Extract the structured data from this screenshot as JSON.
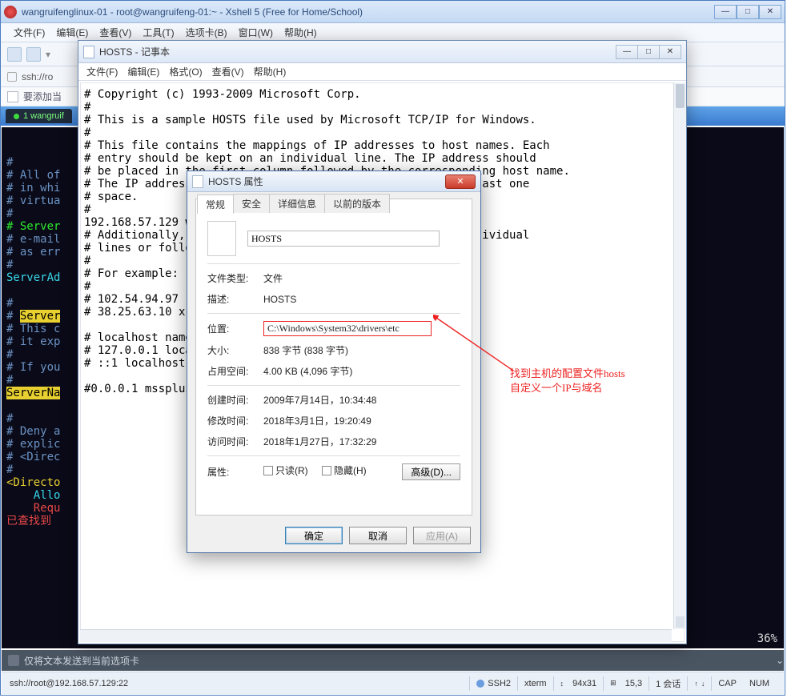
{
  "xshell": {
    "title": "wangruifenglinux-01 - root@wangruifeng-01:~ - Xshell 5 (Free for Home/School)",
    "menu": [
      "文件(F)",
      "编辑(E)",
      "查看(V)",
      "工具(T)",
      "选项卡(B)",
      "窗口(W)",
      "帮助(H)"
    ],
    "addr": "ssh://ro",
    "tip": "要添加当",
    "tab": "1 wangruif",
    "terminal_lines": [
      {
        "t": "#",
        "cls": "hash"
      },
      {
        "t": "# All of",
        "cls": "hash"
      },
      {
        "t": "# in whi",
        "cls": "hash"
      },
      {
        "t": "# virtua",
        "cls": "hash"
      },
      {
        "t": "#",
        "cls": "hash"
      },
      {
        "t": "# Server",
        "cls": "gr"
      },
      {
        "t": "# e-mail",
        "cls": "hash"
      },
      {
        "t": "# as err",
        "cls": "hash"
      },
      {
        "t": "#",
        "cls": "hash"
      },
      {
        "t": "ServerAd",
        "cls": "cy"
      },
      {
        "t": "",
        "cls": ""
      },
      {
        "t": "#",
        "cls": "hash"
      },
      {
        "t": "# ",
        "cls": "hash",
        "extra": "Server",
        "extracls": "ylhl"
      },
      {
        "t": "# This c",
        "cls": "hash"
      },
      {
        "t": "# it exp",
        "cls": "hash"
      },
      {
        "t": "#",
        "cls": "hash"
      },
      {
        "t": "# If you",
        "cls": "hash"
      },
      {
        "t": "#",
        "cls": "hash"
      },
      {
        "t": "ServerNa",
        "cls": "ylhl2"
      },
      {
        "t": "",
        "cls": ""
      },
      {
        "t": "#",
        "cls": "hash"
      },
      {
        "t": "# Deny a",
        "cls": "hash"
      },
      {
        "t": "# explic",
        "cls": "hash"
      },
      {
        "t": "# <Direc",
        "cls": "hash"
      },
      {
        "t": "#",
        "cls": "hash"
      },
      {
        "t": "<Directo",
        "cls": "yl"
      },
      {
        "t": "    Allo",
        "cls": "cy"
      },
      {
        "t": "    Requ",
        "cls": "rd"
      },
      {
        "t": "已查找到",
        "cls": "rd"
      }
    ],
    "pct": "36%",
    "cmdbar": "仅将文本发送到当前选项卡",
    "status": {
      "left": "ssh://root@192.168.57.129:22",
      "ssh": "SSH2",
      "term": "xterm",
      "size": "94x31",
      "pos": "15,3",
      "sess": "1 会话",
      "cap": "CAP",
      "num": "NUM"
    }
  },
  "notepad": {
    "title": "HOSTS - 记事本",
    "menu": [
      "文件(F)",
      "编辑(E)",
      "格式(O)",
      "查看(V)",
      "帮助(H)"
    ],
    "content": "# Copyright (c) 1993-2009 Microsoft Corp.\n#\n# This is a sample HOSTS file used by Microsoft TCP/IP for Windows.\n#\n# This file contains the mappings of IP addresses to host names. Each\n# entry should be kept on an individual line. The IP address should\n# be placed in the first column followed by the corresponding host name.\n# The IP address                                           ast one\n# space.\n#\n192.168.57.129 w\n# Additionally,                                            ividual\n# lines or follo\n#\n# For example:\n#\n# 102.54.94.97 r\n# 38.25.63.10 x.\n\n# localhost name\n# 127.0.0.1 loca\n# ::1 localhost\n\n#0.0.0.1 mssplus"
  },
  "prop": {
    "title": "HOSTS 属性",
    "tabs": [
      "常规",
      "安全",
      "详细信息",
      "以前的版本"
    ],
    "filename": "HOSTS",
    "labels": {
      "type": "文件类型:",
      "typeval": "文件",
      "desc": "描述:",
      "descval": "HOSTS",
      "loc": "位置:",
      "locval": "C:\\Windows\\System32\\drivers\\etc",
      "size": "大小:",
      "sizeval": "838 字节 (838 字节)",
      "disk": "占用空间:",
      "diskval": "4.00 KB (4,096 字节)",
      "ctime": "创建时间:",
      "ctimeval": "2009年7月14日，10:34:48",
      "mtime": "修改时间:",
      "mtimeval": "2018年3月1日，19:20:49",
      "atime": "访问时间:",
      "atimeval": "2018年1月27日，17:32:29",
      "attr": "属性:",
      "readonly": "只读(R)",
      "hidden": "隐藏(H)",
      "adv": "高级(D)..."
    },
    "buttons": {
      "ok": "确定",
      "cancel": "取消",
      "apply": "应用(A)"
    }
  },
  "anno": {
    "l1": "找到主机的配置文件hosts",
    "l2": "自定义一个IP与域名"
  }
}
